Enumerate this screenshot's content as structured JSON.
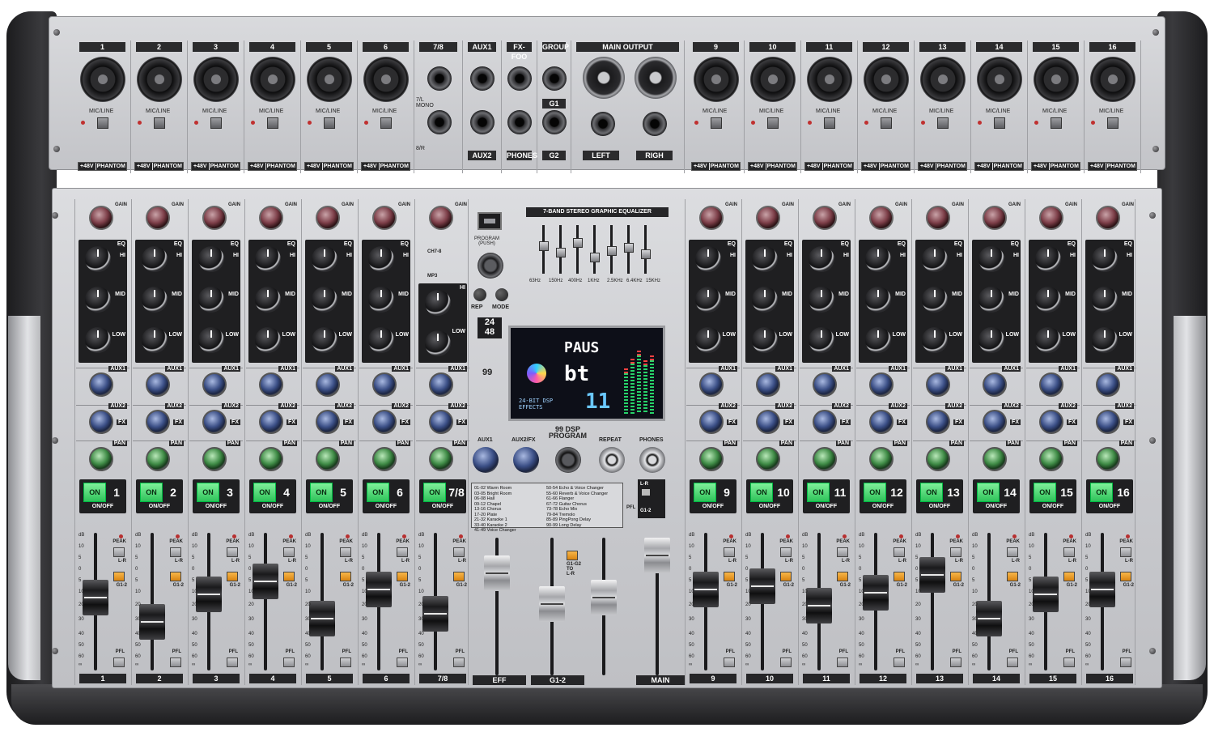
{
  "inputs_top": {
    "channels": [
      "1",
      "2",
      "3",
      "4",
      "5",
      "6"
    ],
    "channels_right": [
      "9",
      "10",
      "11",
      "12",
      "13",
      "14",
      "15",
      "16"
    ],
    "stereo": "7/8",
    "aux1": "AUX1",
    "fxfoo": "FX-FOO",
    "group": "GROUP",
    "main_output": "MAIN OUTPUT",
    "mic_line": "MIC/LINE",
    "plus48v": "+48V",
    "phantom": "PHANTOM",
    "l_mono": "7/L\nMONO",
    "r_label": "8/R",
    "aux2": "AUX2",
    "phones": "PHONES",
    "g1": "G1",
    "g2": "G2",
    "left": "LEFT",
    "right": "RIGH"
  },
  "strip": {
    "gain": "GAIN",
    "eq": "EQ",
    "hi": "HI",
    "mid": "MID",
    "low": "LOW",
    "aux1": "AUX1",
    "aux2": "AUX2",
    "fx": "FX",
    "pan": "PAN",
    "on": "ON",
    "on_off": "ON/OFF",
    "peak": "PEAK",
    "lr": "L-R",
    "g12": "G1-2",
    "pfl": "PFL",
    "ch78_a": "CH7-8",
    "ch78_b": "MP3"
  },
  "channel_numbers_left": [
    "1",
    "2",
    "3",
    "4",
    "5",
    "6",
    "7/8"
  ],
  "channel_numbers_right": [
    "9",
    "10",
    "11",
    "12",
    "13",
    "14",
    "15",
    "16"
  ],
  "fader_scale": [
    "dB",
    "10",
    "5",
    "0",
    "5",
    "10",
    "20",
    "30",
    "40",
    "50",
    "60",
    "∞"
  ],
  "center": {
    "eq_title": "7-BAND STEREO GRAPHIC EQUALIZER",
    "eq_freqs": [
      "63Hz",
      "150Hz",
      "400Hz",
      "1KHz",
      "2.5KHz",
      "6.4KHz",
      "15KHz"
    ],
    "program_push": "PROGRAM\n(PUSH)",
    "rep": "REP",
    "mode": "MODE",
    "bit": "24\n48",
    "dsp99": "99",
    "display_top": "PAUS",
    "display_mid": "bt",
    "display_num": "11",
    "display_small": "24-BIT DSP\nEFFECTS",
    "dsp_program": "99 DSP\nPROGRAM",
    "aux1": "AUX1",
    "aux2fx": "AUX2/FX",
    "repeat": "REPEAT",
    "phones": "PHONES",
    "lr": "L-R",
    "g12": "G1-2",
    "pfl": "PFL",
    "g12_to_lr": "G1-G2\nTO\nL-R",
    "presets_a": "01-02 Warm Room\n03-05 Bright Room\n06-08 Hall\n09-12 Chapel\n13-16 Chorus\n17-20 Plate\n21-32 Karaoke 1\n33-40 Karaoke 2\n41-49 Voice Changer",
    "presets_b": "50-54 Echo & Voice Changer\n55-60 Reverb & Voice Changer\n61-66 Flanger\n67-72 Guitar Chorus\n73-78 Echo Mix\n79-84 Tremolo\n85-89 PingPong Delay\n90-99 Long Delay",
    "eff": "EFF",
    "g12_bus": "G1-2",
    "main": "MAIN"
  }
}
